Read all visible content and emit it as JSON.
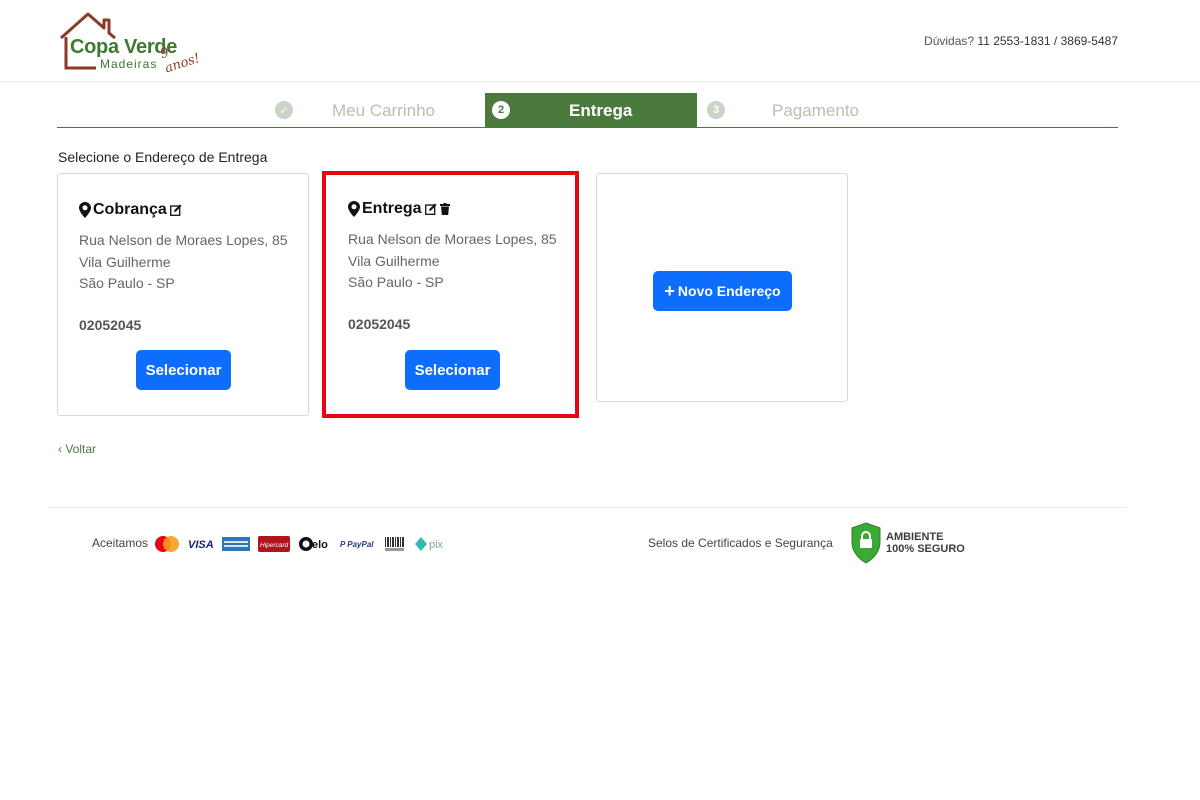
{
  "header": {
    "logo_title": "Copa Verde",
    "logo_sub": "Madeiras",
    "logo_anos": "9 anos!",
    "contact_label": "Dúvidas?",
    "contact_numbers": "11 2553-1831 / 3869-5487"
  },
  "steps": [
    {
      "number": "✓",
      "label": "Meu Carrinho",
      "state": "done"
    },
    {
      "number": "2",
      "label": "Entrega",
      "state": "active"
    },
    {
      "number": "3",
      "label": "Pagamento",
      "state": "pending"
    }
  ],
  "section_title": "Selecione o Endereço de Entrega",
  "addresses": [
    {
      "name": "Cobrança",
      "street": "Rua Nelson de Moraes Lopes, 85",
      "district": "Vila Guilherme",
      "city": "São Paulo - SP",
      "cep": "02052045",
      "button": "Selecionar"
    },
    {
      "name": "Entrega",
      "street": "Rua Nelson de Moraes Lopes, 85",
      "district": "Vila Guilherme",
      "city": "São Paulo - SP",
      "cep": "02052045",
      "button": "Selecionar"
    }
  ],
  "new_address_button": "Novo Endereço",
  "back_link": "Voltar",
  "footer": {
    "accept_label": "Aceitamos",
    "seals_label": "Selos de Certificados e Segurança",
    "secure_line1": "AMBIENTE",
    "secure_line2": "100% SEGURO",
    "payment_icons": [
      "mastercard-icon",
      "visa-icon",
      "amex-icon",
      "hipercard-icon",
      "elo-icon",
      "paypal-icon",
      "boleto-icon",
      "pix-icon"
    ]
  },
  "colors": {
    "brand_green": "#4b7a3d",
    "primary_button": "#0d6efd",
    "highlight_border": "#e30613"
  }
}
